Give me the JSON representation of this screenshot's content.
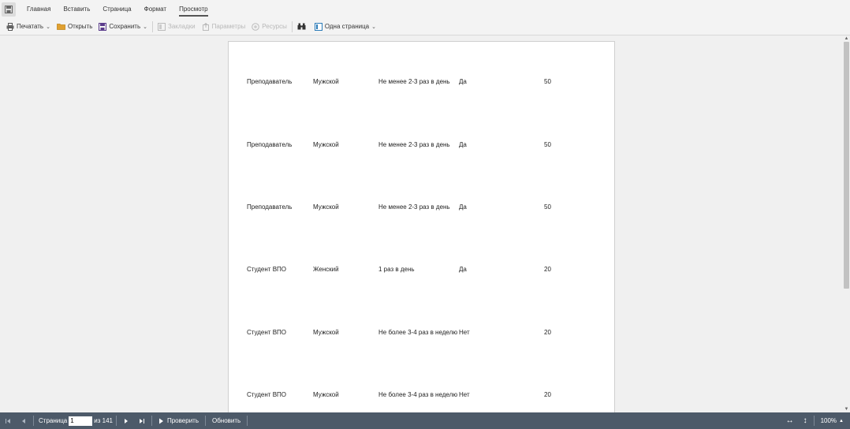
{
  "menubar": {
    "tabs": [
      {
        "label": "Главная"
      },
      {
        "label": "Вставить"
      },
      {
        "label": "Страница"
      },
      {
        "label": "Формат"
      },
      {
        "label": "Просмотр"
      }
    ],
    "active_tab": "Просмотр"
  },
  "toolbar": {
    "print_label": "Печатать",
    "open_label": "Открыть",
    "save_label": "Сохранить",
    "bookmarks_label": "Закладки",
    "parameters_label": "Параметры",
    "resources_label": "Ресурсы",
    "view_mode_label": "Одна страница"
  },
  "report": {
    "rows": [
      {
        "role": "Преподаватель",
        "gender": "Мужской",
        "frequency": "Не менее 2-3 раз в день",
        "answer": "Да",
        "value": "50"
      },
      {
        "role": "Преподаватель",
        "gender": "Мужской",
        "frequency": "Не менее 2-3 раз в день",
        "answer": "Да",
        "value": "50"
      },
      {
        "role": "Преподаватель",
        "gender": "Мужской",
        "frequency": "Не менее 2-3 раз в день",
        "answer": "Да",
        "value": "50"
      },
      {
        "role": "Студент ВПО",
        "gender": "Женский",
        "frequency": "1 раз в день",
        "answer": "Да",
        "value": "20"
      },
      {
        "role": "Студент ВПО",
        "gender": "Мужской",
        "frequency": "Не более 3-4 раз в неделю",
        "answer": "Нет",
        "value": "20"
      },
      {
        "role": "Студент ВПО",
        "gender": "Мужской",
        "frequency": "Не более 3-4 раз в неделю",
        "answer": "Нет",
        "value": "20"
      }
    ]
  },
  "statusbar": {
    "page_label": "Страница",
    "page_value": "1",
    "of_label": "из 141",
    "check_label": "Проверить",
    "refresh_label": "Обновить",
    "zoom": "100%"
  },
  "colors": {
    "statusbar_bg": "#4d5a69",
    "page_bg": "#ffffff",
    "viewer_bg": "#f0f0f0",
    "save_icon": "#5b3c8c",
    "open_icon": "#e0a030",
    "view_icon": "#2a7bb8"
  }
}
